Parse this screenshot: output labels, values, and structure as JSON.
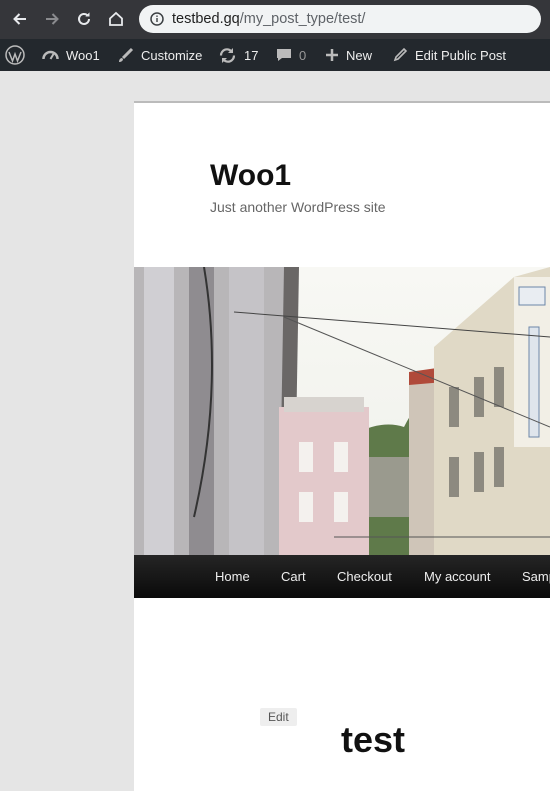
{
  "browser": {
    "url_host": "testbed.gq",
    "url_path": "/my_post_type/test/",
    "icons": [
      "back-arrow-icon",
      "forward-arrow-icon",
      "reload-icon",
      "home-icon",
      "info-icon"
    ]
  },
  "admin_bar": {
    "site_name": "Woo1",
    "customize": "Customize",
    "updates_count": "17",
    "comments_count": "0",
    "new_label": "New",
    "edit_label": "Edit Public Post"
  },
  "site": {
    "title": "Woo1",
    "tagline": "Just another WordPress site"
  },
  "nav": {
    "items": [
      "Home",
      "Cart",
      "Checkout",
      "My account",
      "Samp"
    ]
  },
  "post": {
    "edit_label": "Edit",
    "title": "test"
  },
  "colors": {
    "admin_bar_bg": "#23282d",
    "browser_bar_bg": "#35363a",
    "nav_bg": "#111111"
  }
}
